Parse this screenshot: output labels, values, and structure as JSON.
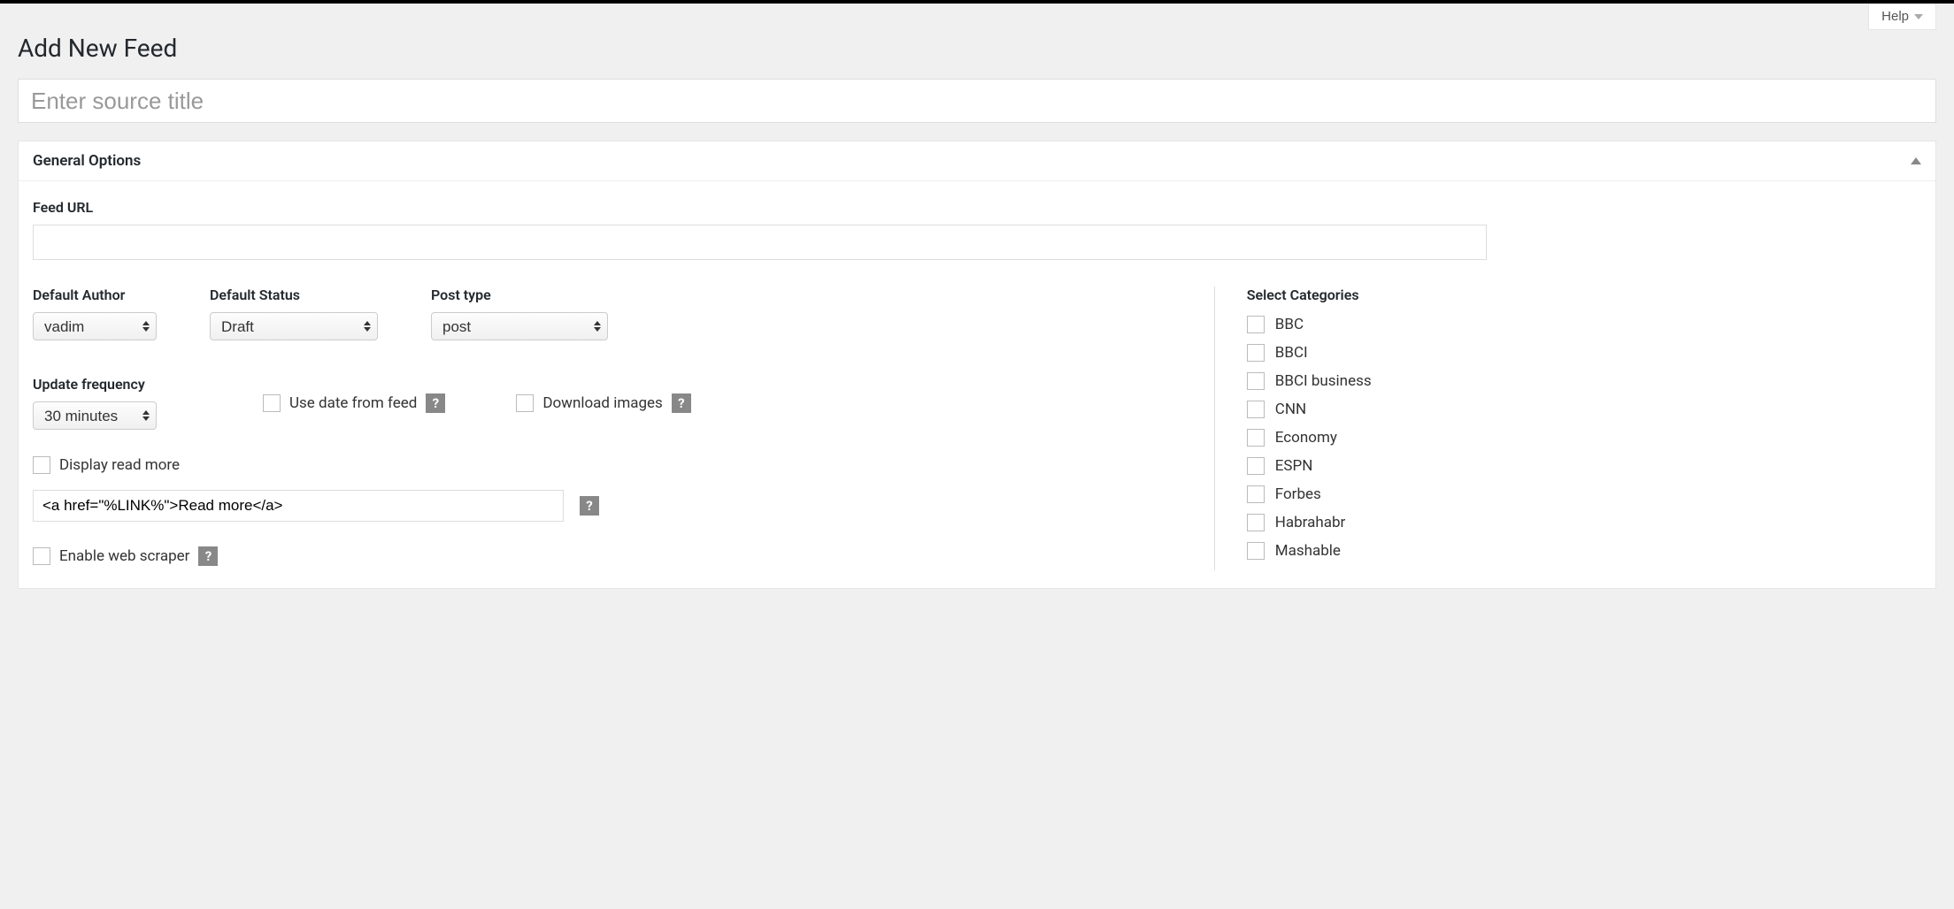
{
  "header": {
    "help_label": "Help",
    "page_title": "Add New Feed"
  },
  "title_input": {
    "placeholder": "Enter source title",
    "value": ""
  },
  "panel": {
    "title": "General Options"
  },
  "fields": {
    "feed_url_label": "Feed URL",
    "feed_url_value": "",
    "default_author_label": "Default Author",
    "default_author_value": "vadim",
    "default_status_label": "Default Status",
    "default_status_value": "Draft",
    "post_type_label": "Post type",
    "post_type_value": "post",
    "update_frequency_label": "Update frequency",
    "update_frequency_value": "30 minutes",
    "use_date_label": "Use date from feed",
    "download_images_label": "Download images",
    "display_read_more_label": "Display read more",
    "read_more_value": "<a href=\"%LINK%\">Read more</a>",
    "enable_scraper_label": "Enable web scraper"
  },
  "categories": {
    "title": "Select Categories",
    "items": [
      "BBC",
      "BBCI",
      "BBCI business",
      "CNN",
      "Economy",
      "ESPN",
      "Forbes",
      "Habrahabr",
      "Mashable"
    ]
  }
}
